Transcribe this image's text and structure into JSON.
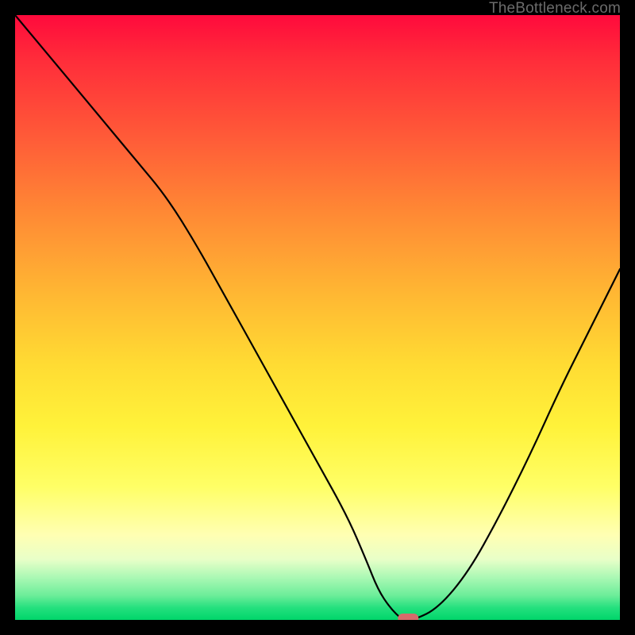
{
  "chart_data": {
    "type": "line",
    "title": "",
    "xlabel": "",
    "ylabel": "",
    "xlim": [
      0,
      100
    ],
    "ylim": [
      0,
      100
    ],
    "grid": false,
    "series": [
      {
        "name": "bottleneck-curve",
        "x": [
          0,
          5,
          10,
          15,
          20,
          25,
          30,
          35,
          40,
          45,
          50,
          55,
          58,
          60,
          62,
          64,
          66,
          70,
          75,
          80,
          85,
          90,
          95,
          100
        ],
        "y": [
          100,
          94,
          88,
          82,
          76,
          70,
          62,
          53,
          44,
          35,
          26,
          17,
          10,
          5,
          2,
          0,
          0,
          2,
          8,
          17,
          27,
          38,
          48,
          58
        ]
      }
    ],
    "annotations": [
      {
        "name": "minimum-marker",
        "x": 65,
        "y": 0,
        "shape": "pill",
        "color": "#d66b6b"
      }
    ]
  },
  "watermark": "TheBottleneck.com",
  "colors": {
    "frame": "#000000",
    "curve": "#000000",
    "marker": "#d66b6b",
    "gradient_top": "#ff0a3c",
    "gradient_bottom": "#00d56a"
  }
}
